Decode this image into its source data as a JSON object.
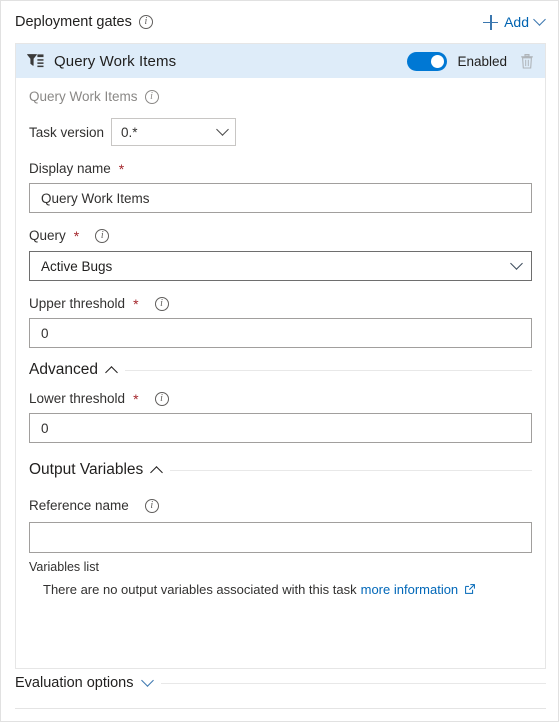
{
  "header": {
    "title": "Deployment gates",
    "info_icon": "info-icon",
    "add_label": "Add",
    "add_plus_icon": "plus-icon",
    "add_chevron_icon": "chevron-down-icon"
  },
  "task": {
    "icon": "query-work-items-icon",
    "title": "Query Work Items",
    "toggle_state": "on",
    "toggle_label": "Enabled",
    "delete_icon": "trash-icon",
    "subtitle": "Query Work Items",
    "subtitle_info_icon": "info-icon",
    "header_bg": "#deecf9",
    "toggle_color": "#0078d4"
  },
  "fields": {
    "task_version": {
      "label": "Task version",
      "value": "0.*",
      "chevron_icon": "chevron-down-icon"
    },
    "display_name": {
      "label": "Display name",
      "required_marker": "*",
      "value": "Query Work Items"
    },
    "query": {
      "label": "Query",
      "required_marker": "*",
      "info_icon": "info-icon",
      "value": "Active Bugs",
      "chevron_icon": "chevron-down-icon"
    },
    "upper_threshold": {
      "label": "Upper threshold",
      "required_marker": "*",
      "info_icon": "info-icon",
      "value": "0"
    },
    "lower_threshold": {
      "label": "Lower threshold",
      "required_marker": "*",
      "info_icon": "info-icon",
      "value": "0"
    },
    "reference_name": {
      "label": "Reference name",
      "info_icon": "info-icon",
      "value": "",
      "placeholder": ""
    }
  },
  "sections": {
    "advanced": {
      "title": "Advanced",
      "state": "expanded",
      "chevron_icon": "chevron-up-icon"
    },
    "output_variables": {
      "title": "Output Variables",
      "state": "expanded",
      "chevron_icon": "chevron-up-icon"
    },
    "evaluation_options": {
      "title": "Evaluation options",
      "state": "collapsed",
      "chevron_icon": "chevron-down-icon"
    }
  },
  "variables_list": {
    "label": "Variables list",
    "empty_text": "There are no output variables associated with this task",
    "link_text": "more information",
    "link_icon": "external-link-icon"
  },
  "colors": {
    "accent": "#0078d4",
    "link": "#0067b8",
    "required": "#a4262c",
    "header_highlight": "#deecf9"
  }
}
